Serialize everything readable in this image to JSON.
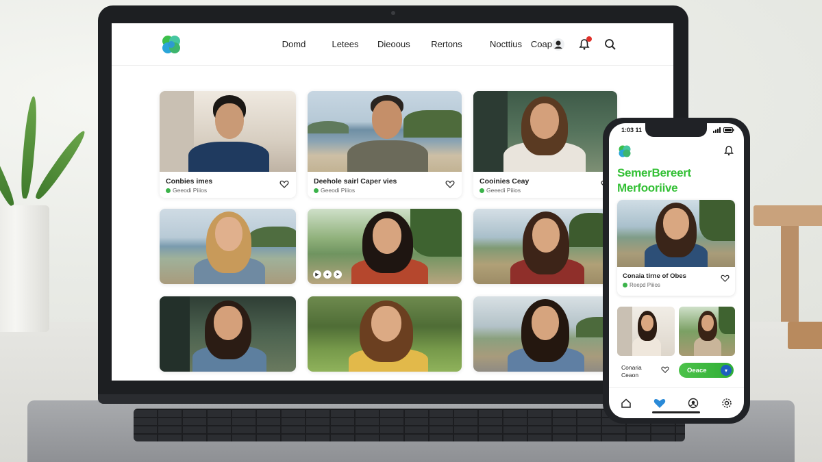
{
  "nav": {
    "links": [
      "Domd",
      "Letees",
      "Dieoous",
      "Rertons",
      "Nocttius",
      "Coape"
    ],
    "icons": [
      "user-icon",
      "bell-icon",
      "search-icon"
    ]
  },
  "cards": [
    {
      "title": "Conbies imes",
      "subtitle": "Geeodi Piiios"
    },
    {
      "title": "Deehole sairl Caper vies",
      "subtitle": "Geeodi Piiios"
    },
    {
      "title": "Cooinies Ceay",
      "subtitle": "Geeedi Piiios"
    }
  ],
  "phone": {
    "time": "1:03 11",
    "heading_line1": "SemerBereert",
    "heading_line2": "Merfooriive",
    "featured_title": "Conaia tirne of Obes",
    "featured_subtitle": "Reepd Piiios",
    "small_title_line1": "Conaria",
    "small_title_line2": "Ceaon",
    "button_label": "Oeace",
    "tabs": [
      "home-icon",
      "heart-icon",
      "profile-icon",
      "settings-icon"
    ]
  },
  "colors": {
    "brand_green": "#34c036",
    "accent_blue": "#1d5fbf",
    "notification_red": "#e0302a"
  }
}
